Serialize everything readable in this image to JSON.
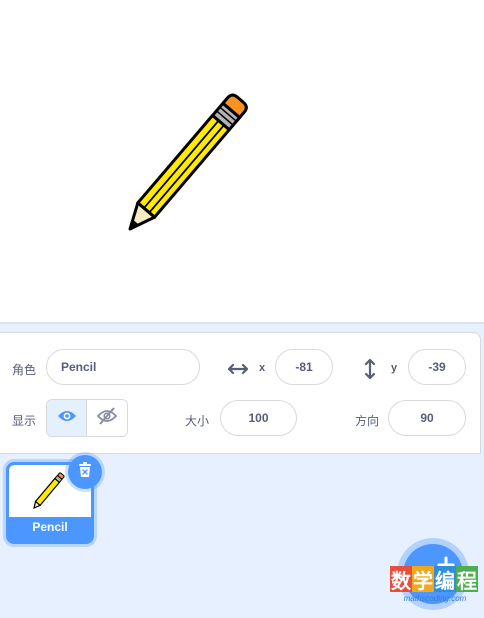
{
  "stage": {
    "sprite_costume": "pencil"
  },
  "sprite_info": {
    "sprite_label": "角色",
    "sprite_name": "Pencil",
    "x_label": "x",
    "x_value": "-81",
    "y_label": "y",
    "y_value": "-39",
    "show_label": "显示",
    "size_label": "大小",
    "size_value": "100",
    "direction_label": "方向",
    "direction_value": "90"
  },
  "sprite_list": [
    {
      "name": "Pencil",
      "selected": true
    }
  ],
  "watermark": {
    "chars": [
      "数",
      "学",
      "编",
      "程"
    ],
    "url": "mathscoding.com"
  },
  "colors": {
    "accent": "#4c97ff",
    "panel_bg": "#e6f0ff",
    "text": "#575e75"
  }
}
